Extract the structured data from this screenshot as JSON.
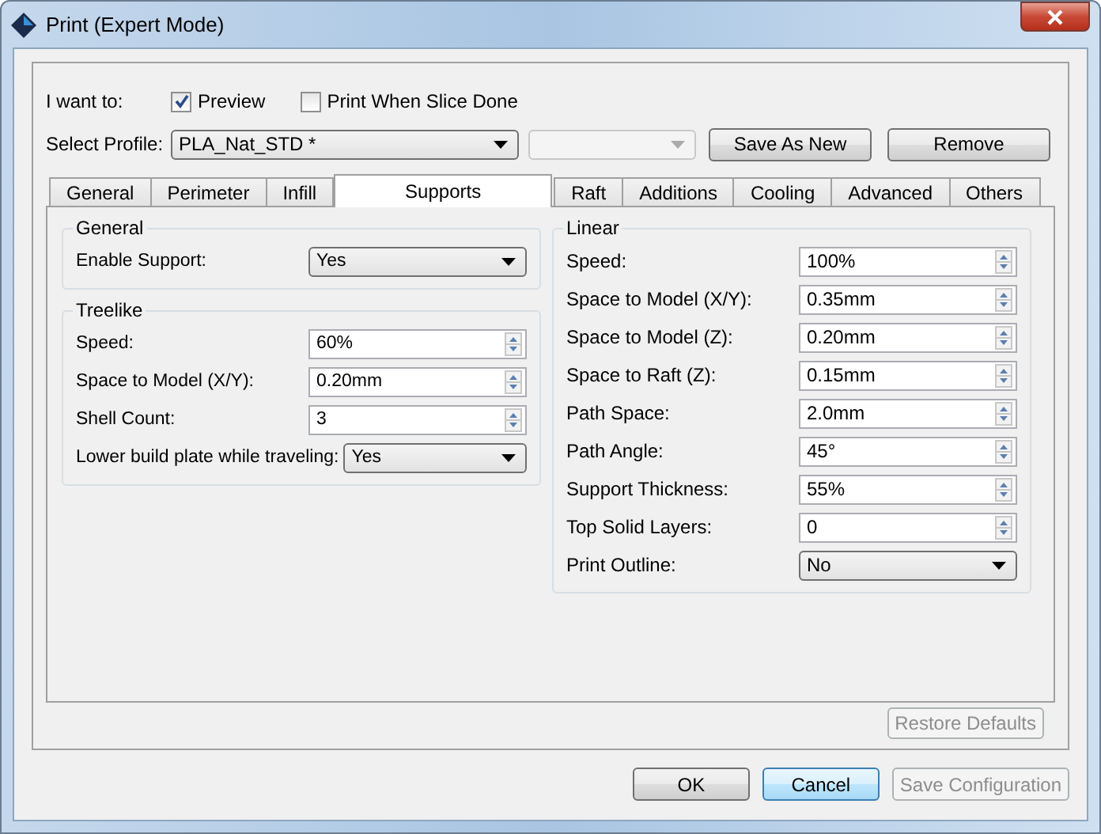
{
  "window": {
    "title": "Print (Expert Mode)"
  },
  "intent": {
    "label": "I want to:",
    "options": [
      {
        "label": "Preview",
        "checked": true
      },
      {
        "label": "Print When Slice Done",
        "checked": false
      }
    ]
  },
  "profile": {
    "label": "Select Profile:",
    "value": "PLA_Nat_STD *",
    "second_disabled": true,
    "buttons": [
      "Save As New",
      "Remove"
    ]
  },
  "tabs": [
    {
      "label": "General",
      "selected": false
    },
    {
      "label": "Perimeter",
      "selected": false
    },
    {
      "label": "Infill",
      "selected": false
    },
    {
      "label": "Supports",
      "selected": true
    },
    {
      "label": "Raft",
      "selected": false
    },
    {
      "label": "Additions",
      "selected": false
    },
    {
      "label": "Cooling",
      "selected": false
    },
    {
      "label": "Advanced",
      "selected": false
    },
    {
      "label": "Others",
      "selected": false
    }
  ],
  "left_groups": [
    {
      "title": "General",
      "rows": [
        {
          "kind": "select",
          "label": "Enable Support:",
          "value": "Yes"
        }
      ]
    },
    {
      "title": "Treelike",
      "rows": [
        {
          "kind": "spin",
          "label": "Speed:",
          "value": "60%"
        },
        {
          "kind": "spin",
          "label": "Space to Model (X/Y):",
          "value": "0.20mm"
        },
        {
          "kind": "spin",
          "label": "Shell Count:",
          "value": "3"
        },
        {
          "kind": "select",
          "label": "Lower build plate while traveling:",
          "value": "Yes"
        }
      ]
    }
  ],
  "right_groups": [
    {
      "title": "Linear",
      "rows": [
        {
          "kind": "spin",
          "label": "Speed:",
          "value": "100%"
        },
        {
          "kind": "spin",
          "label": "Space to Model (X/Y):",
          "value": "0.35mm"
        },
        {
          "kind": "spin",
          "label": "Space to Model (Z):",
          "value": "0.20mm"
        },
        {
          "kind": "spin",
          "label": "Space to Raft (Z):",
          "value": "0.15mm"
        },
        {
          "kind": "spin",
          "label": "Path Space:",
          "value": "2.0mm"
        },
        {
          "kind": "spin",
          "label": "Path Angle:",
          "value": "45°"
        },
        {
          "kind": "spin",
          "label": "Support Thickness:",
          "value": "55%"
        },
        {
          "kind": "spin",
          "label": "Top Solid Layers:",
          "value": "0"
        },
        {
          "kind": "select",
          "label": "Print Outline:",
          "value": "No"
        }
      ]
    }
  ],
  "restore_button": {
    "label": "Restore Defaults",
    "disabled": true
  },
  "buttons": [
    {
      "label": "OK",
      "disabled": false,
      "focused": false
    },
    {
      "label": "Cancel",
      "disabled": false,
      "focused": true
    },
    {
      "label": "Save Configuration",
      "disabled": true,
      "focused": false
    }
  ]
}
